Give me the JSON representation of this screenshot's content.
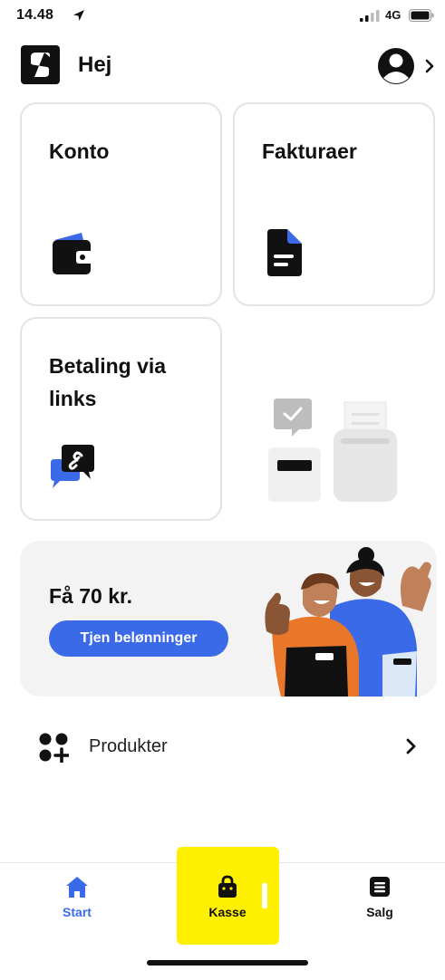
{
  "status_bar": {
    "time": "14.48",
    "network": "4G"
  },
  "header": {
    "greeting": "Hej"
  },
  "tiles": [
    {
      "title": "Konto"
    },
    {
      "title": "Fakturaer"
    },
    {
      "title": "Betaling via links"
    }
  ],
  "promo": {
    "title": "Få 70 kr.",
    "button_label": "Tjen belønninger"
  },
  "products": {
    "label": "Produkter"
  },
  "tabbar": {
    "active_color": "#3b6ae8",
    "highlight_color": "#ffef00",
    "tabs": [
      {
        "label": "Start",
        "icon": "home-icon",
        "active": true
      },
      {
        "label": "Kasse",
        "icon": "bag-icon",
        "active": false
      },
      {
        "label": "Salg",
        "icon": "list-icon",
        "active": false
      }
    ]
  }
}
